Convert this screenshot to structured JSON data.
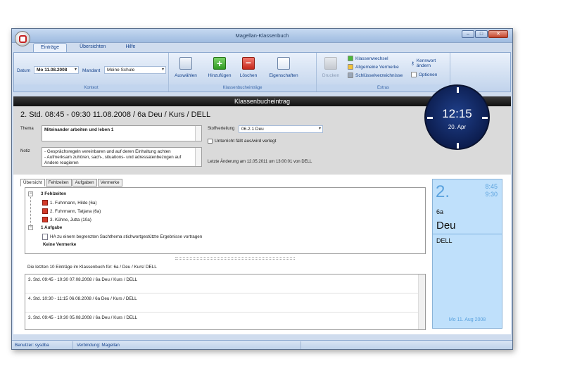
{
  "window": {
    "title": "Magellan-Klassenbuch",
    "controls": {
      "minimize": "–",
      "maximize": "□",
      "close": "✕"
    }
  },
  "tabs": [
    "Einträge",
    "Übersichten",
    "Hilfe"
  ],
  "ribbon": {
    "kontext": {
      "datum_label": "Datum",
      "datum_value": "Mo 11.08.2008",
      "mandant_label": "Mandant",
      "mandant_value": "Meine Schule",
      "group_label": "Kontext"
    },
    "eintraege": {
      "auswaehlen": "Auswählen",
      "hinzufuegen": "Hinzufügen",
      "loeschen": "Löschen",
      "eigenschaften": "Eigenschaften",
      "group_label": "Klassenbucheinträge"
    },
    "extras": {
      "drucken": "Drucken",
      "klassenwechsel": "Klassenwechsel",
      "allgemeine_vermerke": "Allgemeine Vermerke",
      "schluesselverzeichnisse": "Schlüsselverzeichnisse",
      "kennwort": "Kennwort ändern",
      "optionen": "Optionen",
      "group_label": "Extras"
    }
  },
  "header": {
    "title": "Klassenbucheintrag"
  },
  "entry": {
    "title": "2. Std. 08:45 - 09:30 11.08.2008 / 6a Deu / Kurs / DELL",
    "thema_label": "Thema",
    "thema_value": "Miteinander arbeiten und leben 1",
    "notiz_label": "Notiz",
    "notiz_lines": [
      "- Gesprächsregeln vereinbaren und auf deren Einhaltung achten",
      "- Aufmerksam zuhören, sach-, situations- und adressatenbezogen auf",
      "Andere reagieren"
    ],
    "stoffverteilung_label": "Stoffverteilung",
    "stoffverteilung_value": "06.2.1 Deu",
    "unterricht_label": "Unterricht fällt aus/wird verlegt",
    "letzte_aenderung": "Letzte Änderung  am 12.05.2011 um 13:00:01 von DELL"
  },
  "clock": {
    "time": "12:15",
    "date": "20. Apr"
  },
  "subtabs": [
    "Übersicht",
    "Fehlzeiten",
    "Aufgaben",
    "Vermerke"
  ],
  "tree": {
    "fehlzeiten_header": "3 Fehlzeiten",
    "fehlzeiten": [
      "1. Fuhrmann, Hilde (6a)",
      "2. Fuhrmann, Tatjana (6a)",
      "3. Kühne, Jutta (10a)"
    ],
    "aufgabe_header": "1 Aufgabe",
    "aufgabe": "HA zu einem begrenzten Sachthema stichwortgestützte Ergebnisse vortragen",
    "vermerke": "Keine Vermerke"
  },
  "last_entries": {
    "label": "Die letzten 10 Einträge im Klassenbuch für: 6a / Deu / Kurs/ DELL",
    "rows": [
      "3. Std. 09:45 - 10:30 07.08.2008 / 6a Deu / Kurs / DELL",
      "4. Std. 10:30 - 11:15 06.08.2008 / 6a Deu / Kurs / DELL",
      "3. Std. 09:45 - 10:30 05.08.2008 / 6a Deu / Kurs / DELL"
    ]
  },
  "card": {
    "number": "2.",
    "start": "8:45",
    "end": "9:30",
    "klasse": "6a",
    "fach": "Deu",
    "lehrer": "DELL",
    "datum": "Mo 11. Aug 2008"
  },
  "status": {
    "benutzer": "Benutzer: sysdba",
    "verbindung": "Verbindung: Magellan"
  },
  "colors": {
    "accent": "#15428b",
    "card": "#bfe0fb",
    "clock": "#0b1b4b",
    "header": "#111111"
  }
}
